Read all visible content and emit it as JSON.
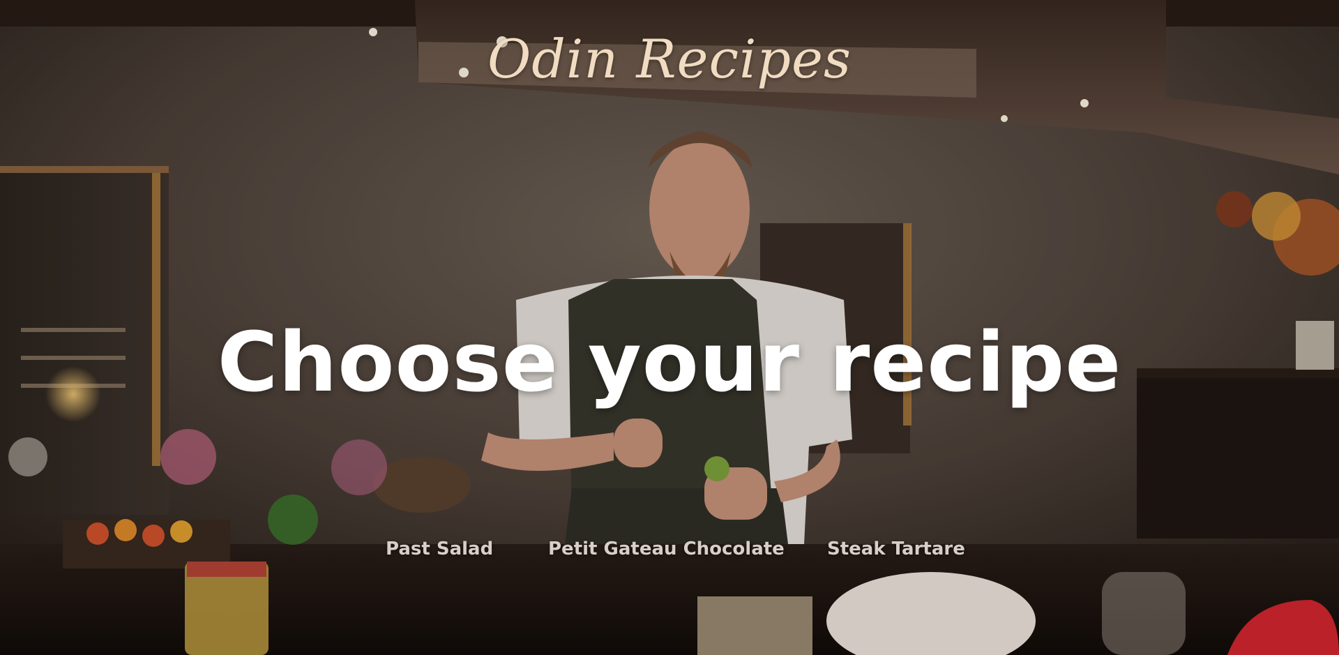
{
  "site": {
    "title": "Odin Recipes"
  },
  "hero": {
    "headline": "Choose your recipe",
    "background": "photo-chef-plating-in-kitchen"
  },
  "recipes": [
    {
      "label": "Past Salad"
    },
    {
      "label": "Petit Gateau Chocolate"
    },
    {
      "label": "Steak Tartare"
    }
  ],
  "colors": {
    "title": "#f1dcc2",
    "headline": "#ffffff",
    "links": "#d7cfc8"
  }
}
